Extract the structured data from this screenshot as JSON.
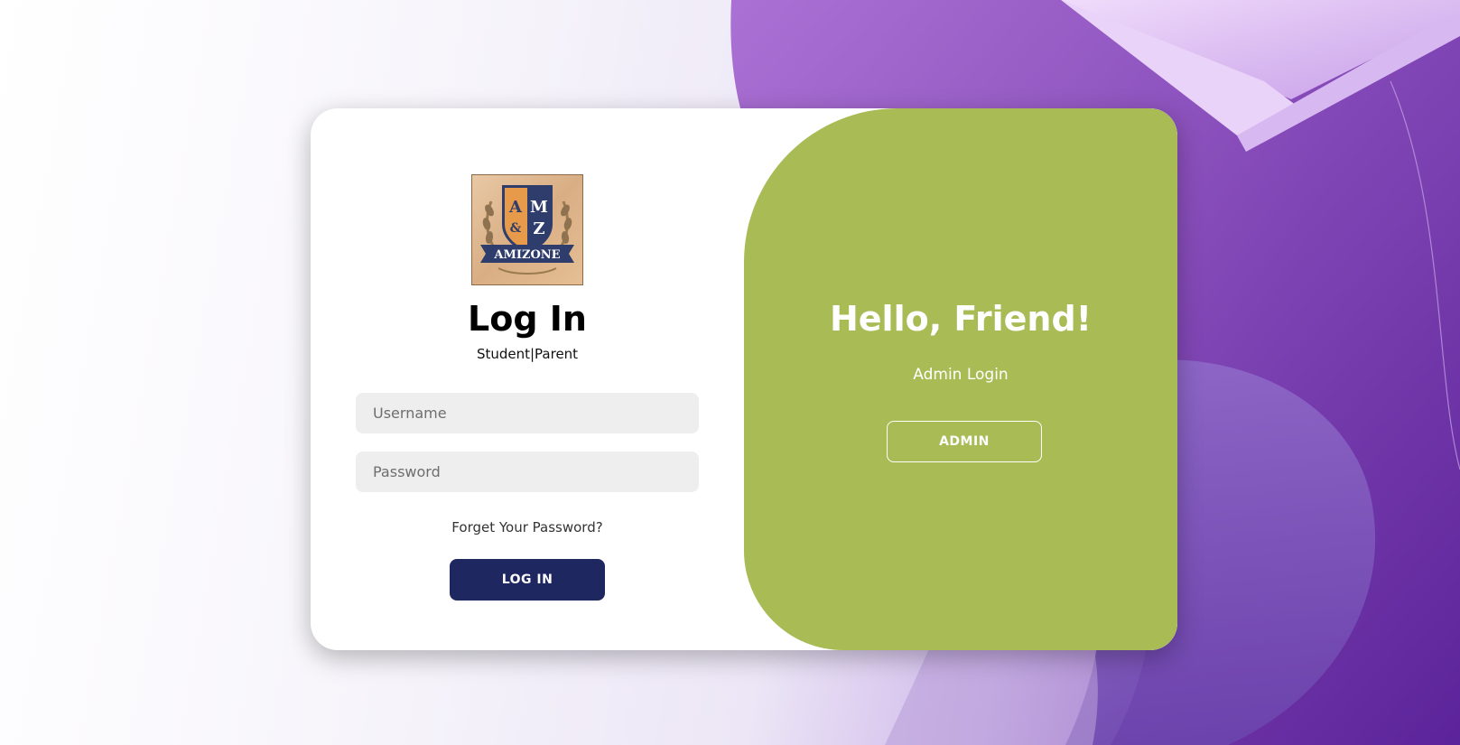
{
  "login": {
    "logo_alt": "AMIZONE",
    "logo_letters": [
      "A",
      "M",
      "&",
      "Z"
    ],
    "logo_banner": "AMIZONE",
    "title": "Log In",
    "subtitle": "Student|Parent",
    "username_placeholder": "Username",
    "password_placeholder": "Password",
    "forgot_label": "Forget Your Password?",
    "submit_label": "LOG IN"
  },
  "admin_panel": {
    "heading": "Hello, Friend!",
    "subtext": "Admin Login",
    "button_label": "ADMIN"
  },
  "colors": {
    "panel_green": "#a9bb55",
    "login_button": "#1f2760",
    "input_bg": "#eeeeee",
    "logo_shield_blue": "#2e3d6b",
    "logo_shield_orange": "#e79a4a"
  }
}
